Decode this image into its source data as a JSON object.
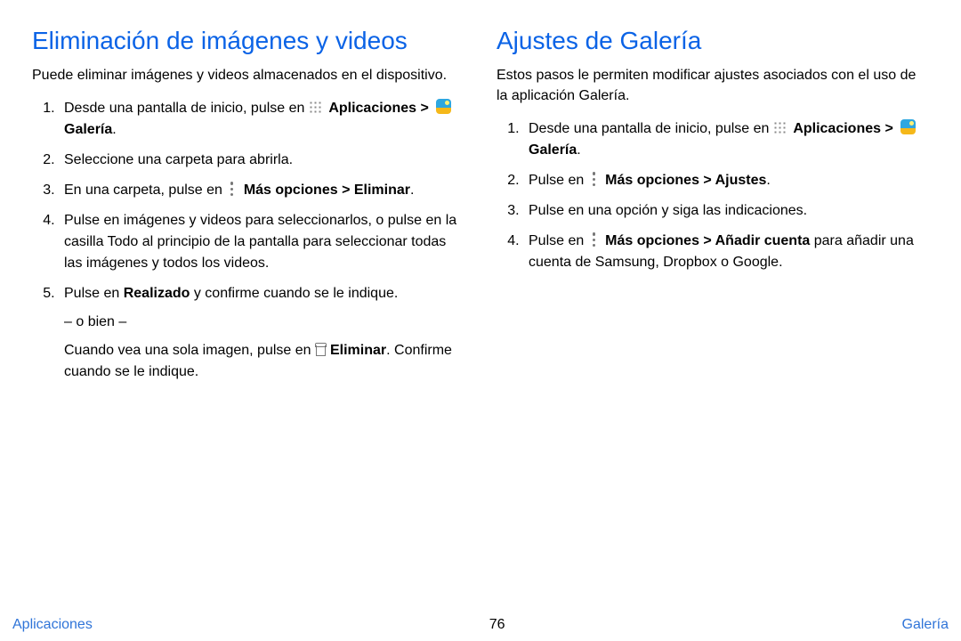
{
  "left": {
    "heading": "Eliminación de imágenes y videos",
    "intro": "Puede eliminar imágenes y videos almacenados en el dispositivo.",
    "s1_pre": "Desde una pantalla de inicio, pulse en ",
    "s1_apps": "Aplicaciones",
    "s1_gt": " > ",
    "s1_gal": "Galería",
    "s1_dot": ".",
    "s2": "Seleccione una carpeta para abrirla.",
    "s3_pre": "En una carpeta, pulse en ",
    "s3_more": "Más opciones > Eliminar",
    "s3_dot": ".",
    "s4": "Pulse en imágenes y videos para seleccionarlos, o pulse en la casilla Todo al principio de la pantalla para seleccionar todas las imágenes y todos los videos.",
    "s5_pre": "Pulse en ",
    "s5_done": "Realizado",
    "s5_post": " y confirme cuando se le indique.",
    "s5_or": "– o bien –",
    "s5_single_pre": "Cuando vea una sola imagen, pulse en ",
    "s5_del": "Eliminar",
    "s5_single_post": ". Confirme cuando se le indique."
  },
  "right": {
    "heading": "Ajustes de Galería",
    "intro": "Estos pasos le permiten modificar ajustes asociados con el uso de la aplicación Galería.",
    "s1_pre": "Desde una pantalla de inicio, pulse en ",
    "s1_apps": "Aplicaciones",
    "s1_gt": " > ",
    "s1_gal": "Galería",
    "s1_dot": ".",
    "s2_pre": "Pulse en ",
    "s2_more": "Más opciones > Ajustes",
    "s2_dot": ".",
    "s3": "Pulse en una opción y siga las indicaciones.",
    "s4_pre": "Pulse en ",
    "s4_more": "Más opciones > Añadir cuenta",
    "s4_post": " para añadir una cuenta de Samsung, Dropbox o Google."
  },
  "footer": {
    "left": "Aplicaciones",
    "center": "76",
    "right": "Galería"
  }
}
